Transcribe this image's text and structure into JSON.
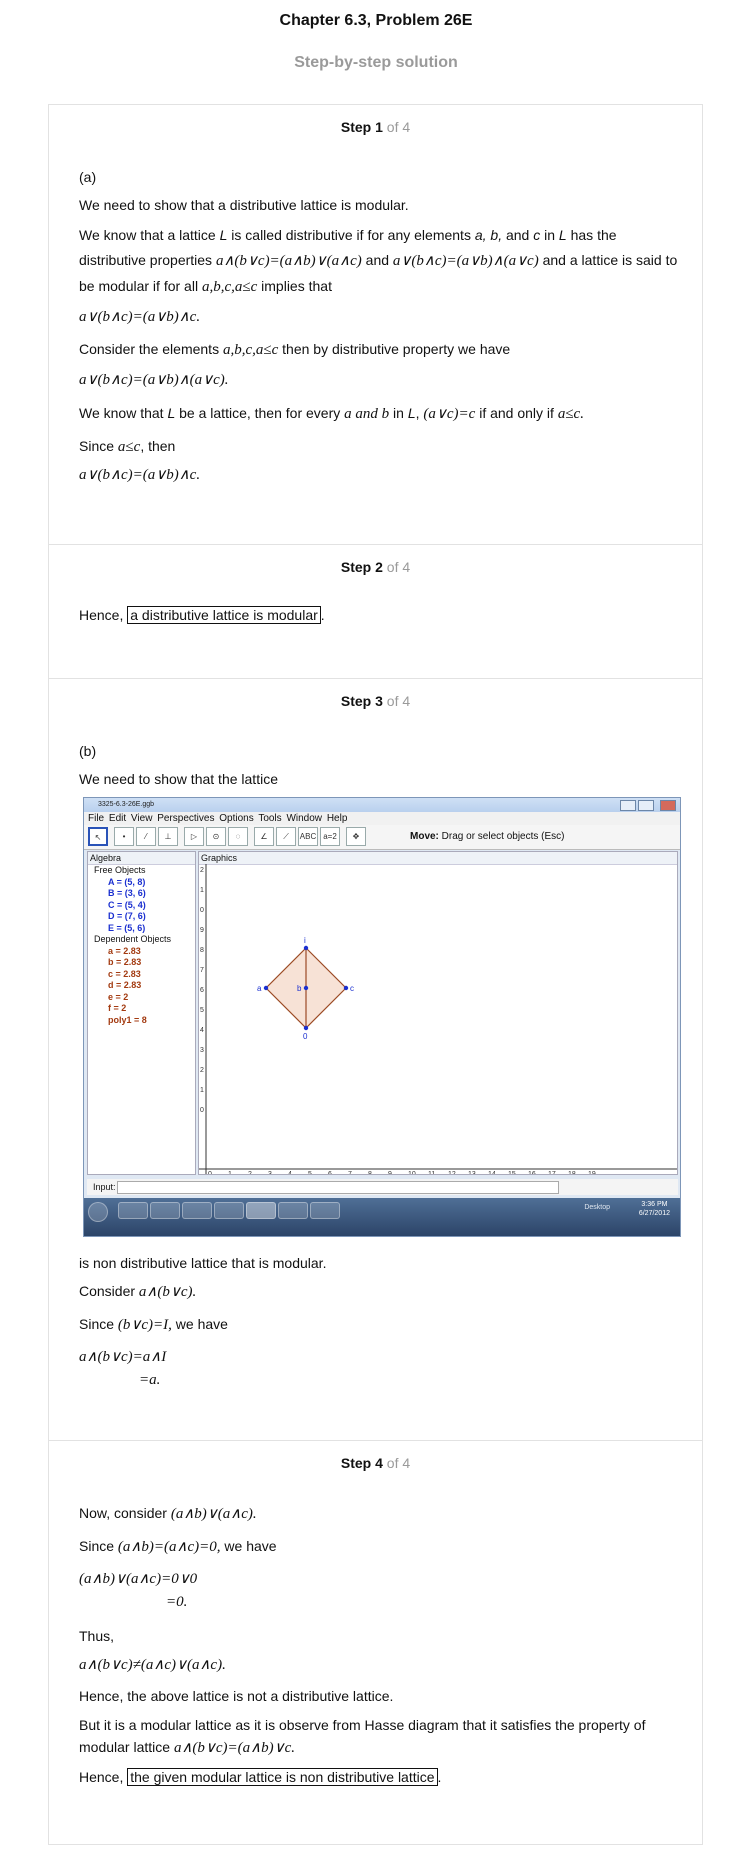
{
  "header": {
    "title": "Chapter 6.3, Problem 26E",
    "subtitle": "Step-by-step solution"
  },
  "step_of": "of 4",
  "steps": [
    {
      "label": "Step",
      "num": "1",
      "part": "(a)",
      "p1": "We need to show that a distributive lattice is modular.",
      "p2_a": "We know that a lattice ",
      "p2_L": "L",
      "p2_b": " is called distributive if for any elements ",
      "p2_abc": "a, b,",
      "p2_c": " and ",
      "p2_cc": "c",
      "p2_d": " in ",
      "p2_L2": "L",
      "p2_e": " has the distributive properties ",
      "eq1": "a∧(b∨c)=(a∧b)∨(a∧c)",
      "and": " and ",
      "eq2": "a∨(b∧c)=(a∨b)∧(a∨c)",
      "p2_f": " and a lattice is said to be modular if for all ",
      "eq3": "a,b,c,a≤c",
      "p2_g": " implies that",
      "eq4": "a∨(b∧c)=(a∨b)∧c.",
      "p3": "Consider the elements ",
      "eq5": "a,b,c,a≤c",
      "p3b": " then by distributive property we have",
      "eq6": "a∨(b∧c)=(a∨b)∧(a∨c).",
      "p4a": "We know that ",
      "p4L": "L",
      "p4b": " be a lattice, then for every ",
      "eq7": "a and b",
      "p4c": " in ",
      "p4L2": "L",
      "p4d": ", ",
      "eq8": "(a∨c)=c",
      "p4e": " if and only if ",
      "eq9": "a≤c.",
      "p5": "Since ",
      "eq10": "a≤c",
      "p5b": ", then",
      "eq11": "a∨(b∧c)=(a∨b)∧c."
    },
    {
      "label": "Step",
      "num": "2",
      "hence": "Hence, ",
      "boxed": "a distributive lattice is modular",
      "dot": "."
    },
    {
      "label": "Step",
      "num": "3",
      "part": "(b)",
      "p1": "We need to show that the lattice",
      "p2": "is non distributive lattice that is modular.",
      "p3": "Consider ",
      "eq1": "a∧(b∨c).",
      "p4": "Since ",
      "eq2": "(b∨c)=I,",
      "p4b": " we have",
      "eq3a": "a∧(b∨c)=a∧I",
      "eq3b": "=a."
    },
    {
      "label": "Step",
      "num": "4",
      "p1": "Now, consider ",
      "eq1": "(a∧b)∨(a∧c).",
      "p2": "Since ",
      "eq2": "(a∧b)=(a∧c)=0,",
      "p2b": " we have",
      "eq3a": "(a∧b)∨(a∧c)=0∨0",
      "eq3b": "=0.",
      "p3": "Thus,",
      "eq4": "a∧(b∨c)≠(a∧c)∨(a∧c).",
      "p4": "Hence, the above lattice is not a distributive lattice.",
      "p5": "But it is a modular lattice as it is observe from Hasse diagram that it satisfies the property of modular lattice ",
      "eq5": "a∧(b∨c)=(a∧b)∨c.",
      "hence": "Hence, ",
      "boxed": "the given modular lattice is non distributive lattice",
      "dot": "."
    }
  ],
  "screenshot": {
    "window_title": "3325-6.3-26E.ggb",
    "menu": [
      "File",
      "Edit",
      "View",
      "Perspectives",
      "Options",
      "Tools",
      "Window",
      "Help"
    ],
    "move_bold": "Move:",
    "move_text": " Drag or select objects (Esc)",
    "tool_abc": "ABC",
    "tool_slider": "a=2",
    "algebra": "Algebra",
    "graphics": "Graphics",
    "free_head": "Free Objects",
    "free": [
      "A = (5, 8)",
      "B = (3, 6)",
      "C = (5, 4)",
      "D = (7, 6)",
      "E = (5, 6)"
    ],
    "dep_head": "Dependent Objects",
    "dep": [
      "a = 2.83",
      "b = 2.83",
      "c = 2.83",
      "d = 2.83",
      "e = 2",
      "f = 2",
      "poly1 = 8"
    ],
    "y_ticks": [
      "2",
      "1",
      "0",
      "9",
      "8",
      "7",
      "6",
      "5",
      "4",
      "3",
      "2",
      "1",
      "0"
    ],
    "x_ticks": [
      "0",
      "1",
      "2",
      "3",
      "4",
      "5",
      "6",
      "7",
      "8",
      "9",
      "10",
      "11",
      "12",
      "13",
      "14",
      "15",
      "16",
      "17",
      "18",
      "19"
    ],
    "labels": {
      "top": "i",
      "left": "a",
      "mid": "b",
      "right": "c",
      "bottom": "0"
    },
    "input_label": "Input:",
    "desktop": "Desktop",
    "time": "3:36 PM",
    "date": "6/27/2012"
  },
  "colors": {
    "point": "#1a2fd0",
    "dependent": "#a33a10",
    "fill": "#f7e2d6",
    "edge": "#9c4a24"
  }
}
